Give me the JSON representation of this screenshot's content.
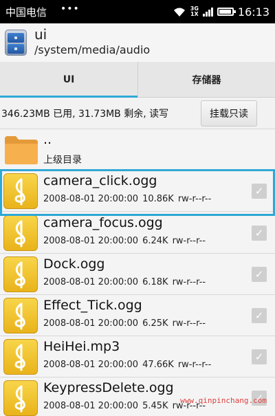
{
  "status_bar": {
    "carrier": "中国电信",
    "dots": "•••",
    "network_top": "3G",
    "network_bottom": "1X",
    "time": "16:13",
    "icons": [
      "wifi-icon",
      "signal-icon",
      "battery-icon"
    ]
  },
  "title_bar": {
    "app_icon": "file-manager-icon",
    "title": "ui",
    "path": "/system/media/audio"
  },
  "tabs": [
    {
      "label": "UI",
      "active": true
    },
    {
      "label": "存储器",
      "active": false
    }
  ],
  "storage": {
    "info": "346.23MB 已用, 31.73MB 剩余, 读写",
    "mount_button": "挂载只读"
  },
  "list": {
    "parent": {
      "name": "..",
      "label": "上级目录",
      "icon": "folder-icon"
    },
    "files": [
      {
        "name": "camera_click.ogg",
        "date": "2008-08-01 20:00:00",
        "size": "10.86K",
        "perms": "rw-r--r--",
        "selected": true
      },
      {
        "name": "camera_focus.ogg",
        "date": "2008-08-01 20:00:00",
        "size": "6.24K",
        "perms": "rw-r--r--",
        "selected": false
      },
      {
        "name": "Dock.ogg",
        "date": "2008-08-01 20:00:00",
        "size": "6.18K",
        "perms": "rw-r--r--",
        "selected": false
      },
      {
        "name": "Effect_Tick.ogg",
        "date": "2008-08-01 20:00:00",
        "size": "6.25K",
        "perms": "rw-r--r--",
        "selected": false
      },
      {
        "name": "HeiHei.mp3",
        "date": "2008-08-01 20:00:00",
        "size": "47.66K",
        "perms": "rw-r--r--",
        "selected": false
      },
      {
        "name": "KeypressDelete.ogg",
        "date": "2008-08-01 20:00:00",
        "size": "5.45K",
        "perms": "rw-r--r--",
        "selected": false
      }
    ],
    "file_icon": "music-note-icon",
    "checkbox_icon": "check-icon"
  },
  "watermark": "www.qinpinchang.com",
  "colors": {
    "accent": "#2ea8d6",
    "file_icon": "#f0c12a",
    "status_bar": "#000000"
  }
}
